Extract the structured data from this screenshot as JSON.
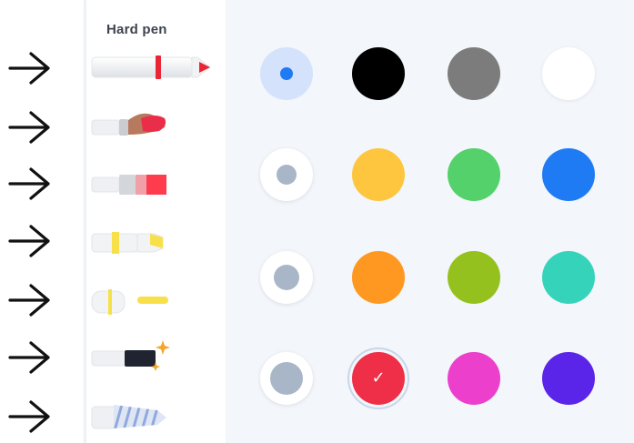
{
  "tool_panel": {
    "title": "Hard pen",
    "tools": [
      {
        "icon": "hard-pen-icon",
        "selected": true
      },
      {
        "icon": "paintbrush-icon"
      },
      {
        "icon": "flat-brush-icon"
      },
      {
        "icon": "highlighter-icon"
      },
      {
        "icon": "marker-icon"
      },
      {
        "icon": "magic-pen-icon"
      },
      {
        "icon": "pattern-brush-icon"
      }
    ]
  },
  "annotations": {
    "arrow_icon": "arrow-right-icon",
    "arrow_count": 7
  },
  "color_panel": {
    "sizes": [
      {
        "label": "size-1",
        "selected": true
      },
      {
        "label": "size-2"
      },
      {
        "label": "size-3"
      },
      {
        "label": "size-4"
      }
    ],
    "colors": [
      "#000000",
      "#7c7c7c",
      "#ffffff",
      "#fdc63e",
      "#54d16a",
      "#1f7bf4",
      "#ff9820",
      "#95c11f",
      "#36d3bb",
      "#ef2f47",
      "#ec3fcb",
      "#5a25e8"
    ],
    "selected_color": "#ef2f47",
    "check_glyph": "✓"
  }
}
